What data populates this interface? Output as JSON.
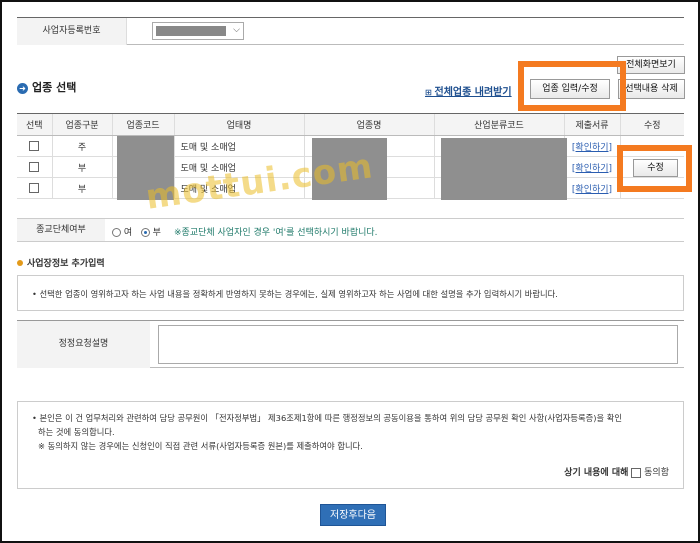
{
  "business_no": {
    "label": "사업자등록번호"
  },
  "top_buttons": {
    "full_screen": "전체화면보기"
  },
  "industry_section": {
    "title": "업종 선택",
    "download_link": "전체업종 내려받기",
    "input_button": "업종 입력/수정",
    "delete_button": "선택내용 삭제"
  },
  "table": {
    "headers": [
      "선택",
      "업종구분",
      "업종코드",
      "업태명",
      "업종명",
      "산업분류코드",
      "제출서류",
      "수정"
    ],
    "rows": [
      {
        "type": "주",
        "business_type": "도매 및 소매업",
        "doc": "[확인하기]",
        "edit": ""
      },
      {
        "type": "부",
        "business_type": "도매 및 소매업",
        "doc": "[확인하기]",
        "edit": "수정"
      },
      {
        "type": "부",
        "business_type": "도매 및 소매업",
        "doc": "[확인하기]",
        "edit": ""
      }
    ]
  },
  "watermark": "mottui.com",
  "religion": {
    "label": "종교단체여부",
    "opt_yes": "여",
    "opt_no": "부",
    "selected": "부",
    "note": "※종교단체 사업자인 경우 '여'를 선택하시기 바랍니다."
  },
  "extra_section": {
    "title": "사업장정보 추가입력",
    "desc": "• 선택한 업종이 영위하고자 하는 사업 내용을 정확하게 반영하지 못하는 경우에는, 실제 영위하고자 하는 사업에 대한 설명을 추가 입력하시기 바랍니다.",
    "field_label": "정정요청설명"
  },
  "consent": {
    "line1": "• 본인은 이 건 업무처리와 관련하여 담당 공무원이 「전자정부법」 제36조제1항에 따른 행정정보의 공동이용을 통하여 위의 담당 공무원 확인 사항(사업자등록증)을 확인",
    "line2": "하는 것에 동의합니다.",
    "line3": "※ 동의하지 않는 경우에는 신청인이 직접 관련 서류(사업자등록증 원본)를 제출하여야 합니다.",
    "agree_prefix": "상기 내용에 대해",
    "agree_label": "동의함"
  },
  "save_button": "저장후다음",
  "colors": {
    "accent": "#2f6fb6",
    "highlight": "#f47a20"
  }
}
